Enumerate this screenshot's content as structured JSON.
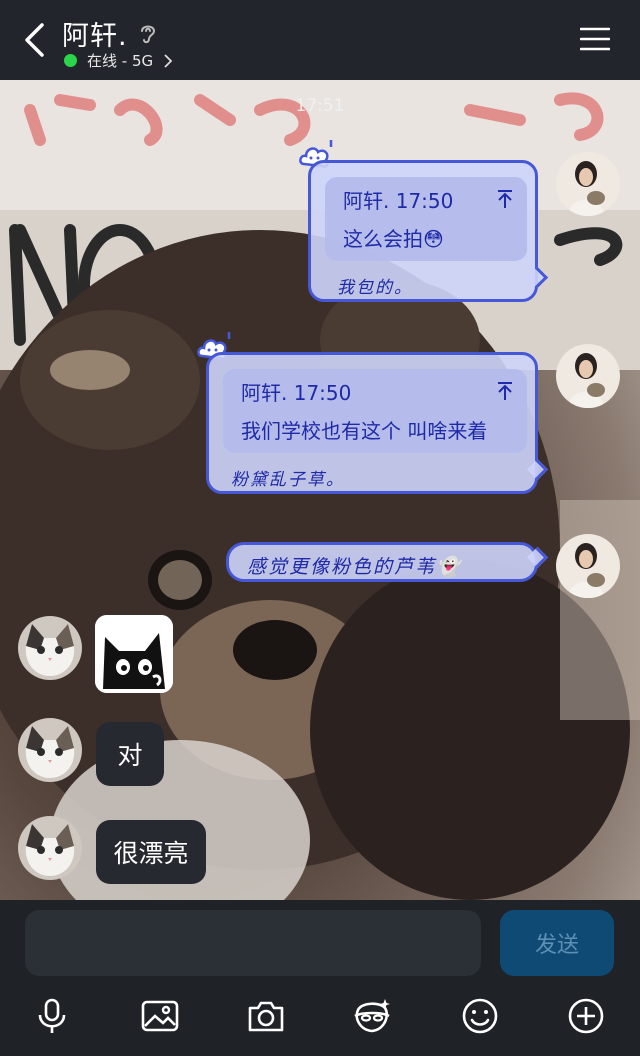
{
  "header": {
    "title": "阿轩.",
    "status_text": "在线 - 5G"
  },
  "chat": {
    "timestamp": "17:51",
    "messages": [
      {
        "direction": "outgoing",
        "quote_meta": "阿轩. 17:50",
        "quote_text": "这么会拍😳",
        "text": "我包的。"
      },
      {
        "direction": "outgoing",
        "quote_meta": "阿轩. 17:50",
        "quote_text": "我们学校也有这个 叫啥来着",
        "text": "粉黛乱子草。"
      },
      {
        "direction": "outgoing",
        "text": "感觉更像粉色的芦苇👻"
      },
      {
        "direction": "incoming",
        "sticker": "black-cat-sticker"
      },
      {
        "direction": "incoming",
        "text": "对"
      },
      {
        "direction": "incoming",
        "text": "很漂亮"
      }
    ]
  },
  "input": {
    "value": "",
    "send_label": "发送"
  },
  "toolbar": {
    "icons": [
      "microphone-icon",
      "image-icon",
      "camera-icon",
      "face-mask-icon",
      "emoji-icon",
      "plus-icon"
    ]
  },
  "colors": {
    "header_bg": "#22252b",
    "online": "#2bd44a",
    "bubble_border": "#4657d8",
    "bubble_text": "#1e2aa6",
    "send_bg": "#0e4a73"
  }
}
